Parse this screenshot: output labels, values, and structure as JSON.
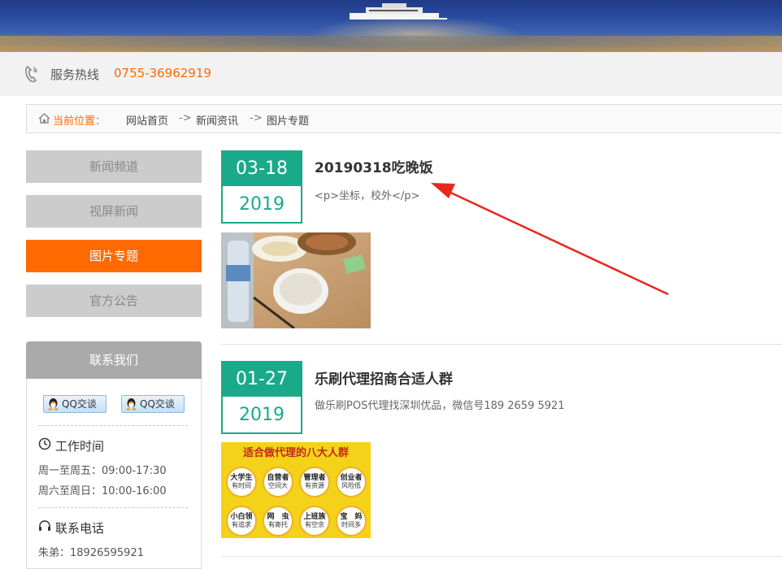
{
  "hotline": {
    "label": "服务热线",
    "number": "0755-36962919"
  },
  "breadcrumb": {
    "label": "当前位置：",
    "items": [
      "网站首页",
      "新闻资讯",
      "图片专题"
    ],
    "separator": "->"
  },
  "sidebar": {
    "nav": [
      {
        "label": "新闻频道",
        "active": false
      },
      {
        "label": "视屏新闻",
        "active": false
      },
      {
        "label": "图片专题",
        "active": true
      },
      {
        "label": "官方公告",
        "active": false
      }
    ],
    "contact": {
      "title": "联系我们",
      "qq_buttons": [
        "QQ交谈",
        "QQ交谈"
      ],
      "work_time_title": "工作时间",
      "work_time": [
        "周一至周五：09:00-17:30",
        "周六至周日：10:00-16:00"
      ],
      "phone_title": "联系电话",
      "phone": "朱弟：18926595921"
    }
  },
  "news": [
    {
      "date_md": "03-18",
      "date_y": "2019",
      "title": "20190318吃晚饭",
      "summary": "<p>坐标，校外</p>"
    },
    {
      "date_md": "01-27",
      "date_y": "2019",
      "title": "乐刷代理招商合适人群",
      "summary": "做乐刷POS代理找深圳优品，微信号189 2659 5921",
      "poster": {
        "title": "适合做代理的八大人群",
        "circles": [
          {
            "top": "大学生",
            "sub": "有时间"
          },
          {
            "top": "自营者",
            "sub": "空间大"
          },
          {
            "top": "管理者",
            "sub": "有资源"
          },
          {
            "top": "创业者",
            "sub": "风险低"
          },
          {
            "top": "小白领",
            "sub": "有追求"
          },
          {
            "top": "网　虫",
            "sub": "有寄托"
          },
          {
            "top": "上班族",
            "sub": "有空余"
          },
          {
            "top": "宝　妈",
            "sub": "时间多"
          }
        ]
      }
    }
  ],
  "colors": {
    "accent": "#ff6a00",
    "teal": "#1aaa8a",
    "annotation_arrow": "#e8281e"
  }
}
